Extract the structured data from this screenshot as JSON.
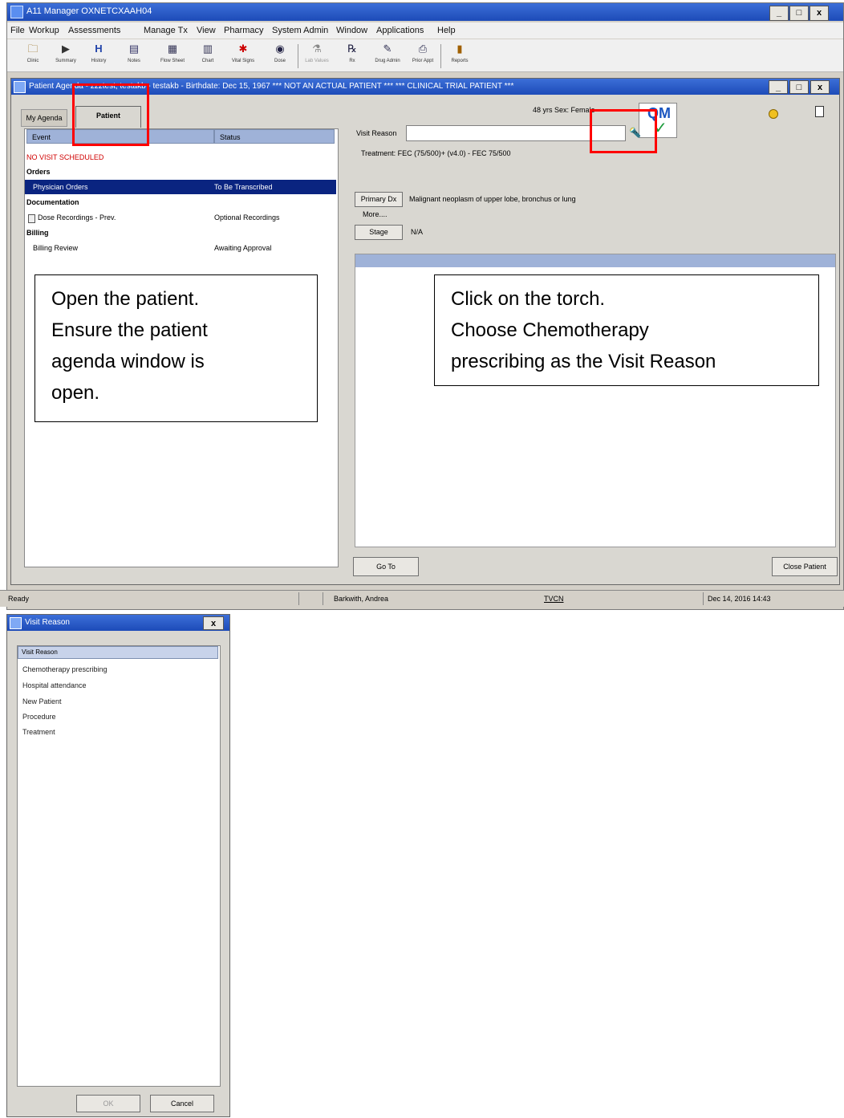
{
  "app": {
    "title": "A11 Manager OXNETCXAAH04",
    "window_buttons": [
      "_",
      "□",
      "x"
    ]
  },
  "menu": [
    "File",
    "Workup",
    "Assessments",
    "Manage Tx",
    "View",
    "Pharmacy",
    "System Admin",
    "Window",
    "Applications",
    "Help"
  ],
  "toolbar": [
    {
      "label": "Clinic",
      "icon": "folder-icon",
      "glyph": "🗀"
    },
    {
      "label": "Summary",
      "icon": "summary-icon",
      "glyph": "▶"
    },
    {
      "label": "History",
      "icon": "history-icon",
      "glyph": "H"
    },
    {
      "label": "Notes",
      "icon": "notes-icon",
      "glyph": "▤"
    },
    {
      "label": "Flow Sheet",
      "icon": "flowsheet-icon",
      "glyph": "▦"
    },
    {
      "label": "Chart",
      "icon": "chart-icon",
      "glyph": "▥"
    },
    {
      "label": "Vital Signs",
      "icon": "vitals-icon",
      "glyph": "✱"
    },
    {
      "label": "Dose",
      "icon": "dose-icon",
      "glyph": "◉"
    },
    {
      "label": "Lab Values",
      "icon": "lab-icon",
      "glyph": "⚗"
    },
    {
      "label": "Rx",
      "icon": "rx-icon",
      "glyph": "℞"
    },
    {
      "label": "Drug Admin",
      "icon": "drug-admin-icon",
      "glyph": "✎"
    },
    {
      "label": "Prior Appt",
      "icon": "prior-appt-icon",
      "glyph": "⎙"
    },
    {
      "label": "Reports",
      "icon": "reports-icon",
      "glyph": "▮"
    }
  ],
  "agenda": {
    "title": "Patient Agenda - zzztest, testakb - testakb - Birthdate: Dec 15, 1967 *** NOT AN ACTUAL PATIENT *** *** CLINICAL TRIAL PATIENT ***",
    "tabs": [
      "My Agenda",
      "Patient"
    ],
    "age_sex": "48 yrs   Sex: Female",
    "columns": [
      "Event",
      "Status"
    ],
    "rows": [
      {
        "event": "NO VISIT SCHEDULED",
        "status": ""
      },
      {
        "event": "Orders",
        "status": ""
      },
      {
        "event": "Physician Orders",
        "status": "To Be Transcribed"
      },
      {
        "event": "Documentation",
        "status": ""
      },
      {
        "event": "Dose Recordings - Prev.",
        "status": "Optional Recordings"
      },
      {
        "event": "Billing",
        "status": ""
      },
      {
        "event": "Billing Review",
        "status": "Awaiting Approval"
      }
    ],
    "visit_reason_label": "Visit Reason",
    "visit_reason_value": "",
    "treatment": "Treatment: FEC (75/500)+ (v4.0) - FEC 75/500",
    "primary_dx_button": "Primary Dx",
    "primary_dx_value": "Malignant neoplasm of upper lobe, bronchus or lung",
    "more_label": "More....",
    "stage_button": "Stage",
    "stage_value": "N/A",
    "goto_button": "Go To",
    "close_patient_button": "Close Patient",
    "qm_logo": "QM"
  },
  "notes": {
    "left": [
      "Open the patient.",
      "Ensure the patient",
      "agenda window is",
      "open."
    ],
    "right": [
      "Click on the torch.",
      "Choose Chemotherapy",
      "prescribing as the Visit Reason"
    ]
  },
  "statusbar": {
    "ready": "Ready",
    "user": "Barkwith, Andrea",
    "location": "TVCN",
    "datetime": "Dec 14, 2016 14:43"
  },
  "dialog": {
    "title": "Visit Reason",
    "close": "x",
    "header": "Visit Reason",
    "items": [
      "Chemotherapy prescribing",
      "Hospital attendance",
      "New Patient",
      "Procedure",
      "Treatment"
    ],
    "ok": "OK",
    "cancel": "Cancel"
  }
}
